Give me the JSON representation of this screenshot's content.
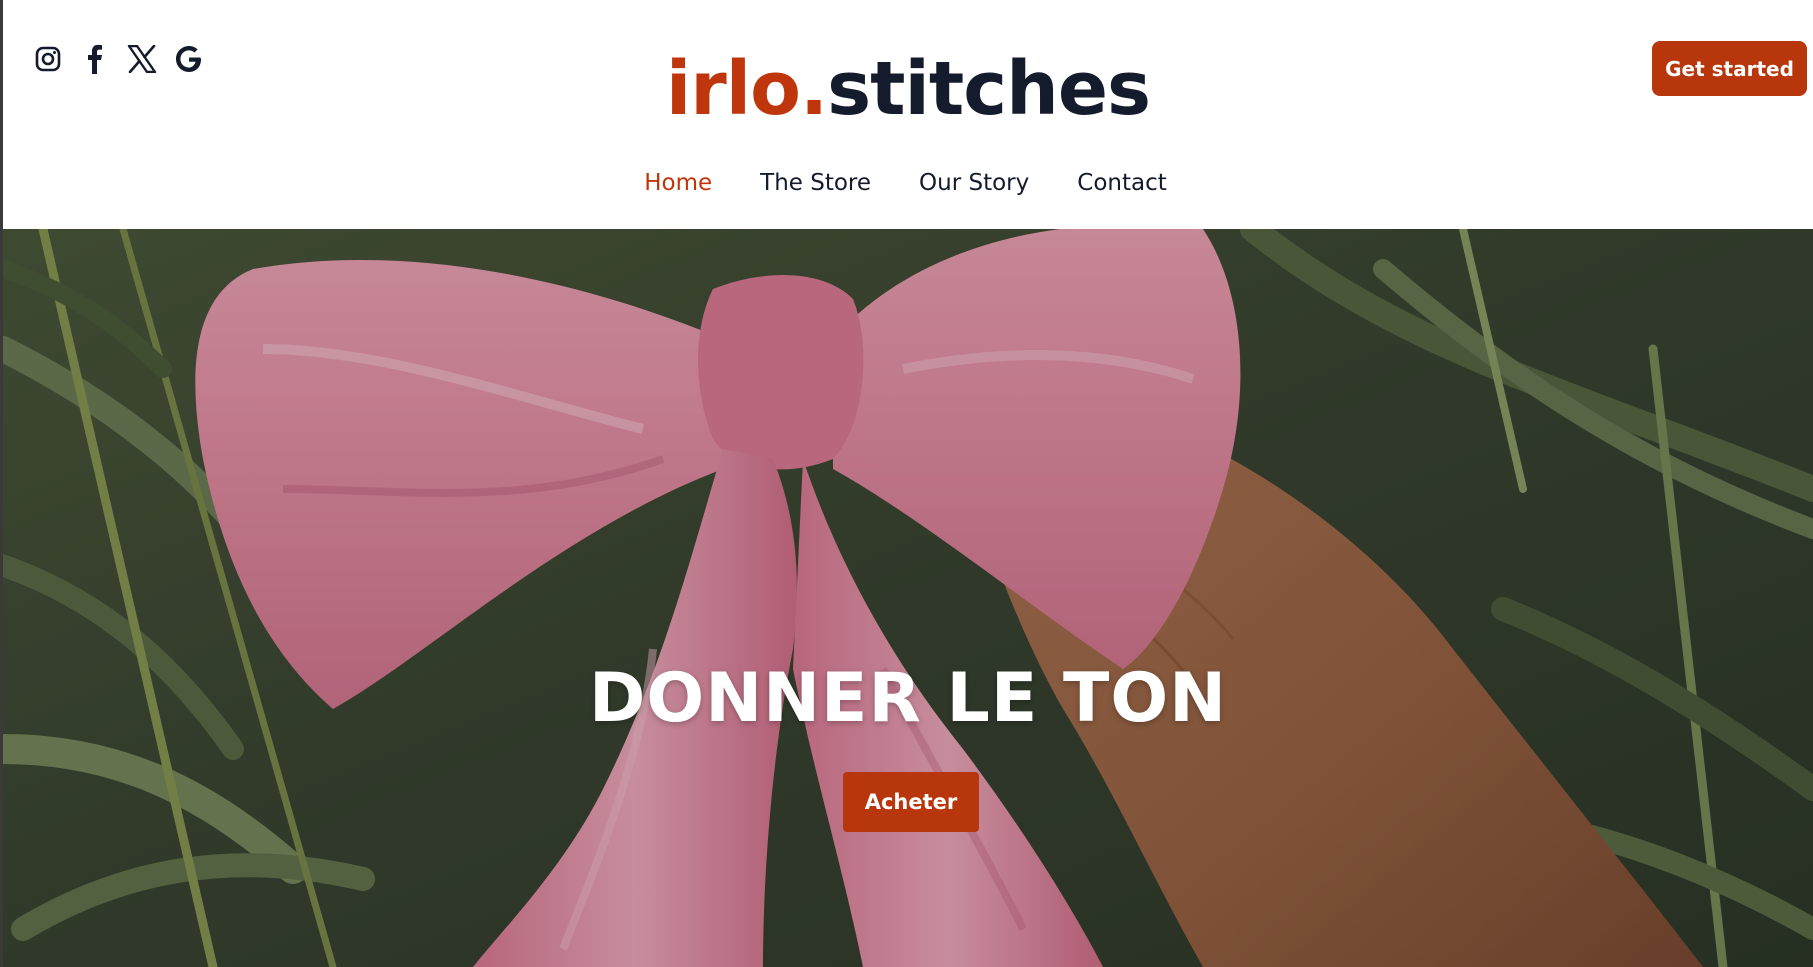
{
  "header": {
    "logo": {
      "part1": "irlo",
      "dot": ".",
      "part2": "stitches"
    },
    "cta_label": "Get started",
    "socials": [
      "instagram-icon",
      "facebook-icon",
      "x-icon",
      "google-icon"
    ]
  },
  "nav": {
    "items": [
      {
        "label": "Home",
        "active": true
      },
      {
        "label": "The Store",
        "active": false
      },
      {
        "label": "Our Story",
        "active": false
      },
      {
        "label": "Contact",
        "active": false
      }
    ]
  },
  "hero": {
    "title": "DONNER LE TON",
    "button_label": "Acheter",
    "image_subject": "pink satin bow held by hand against green foliage"
  },
  "colors": {
    "accent": "#b8360c",
    "logo_accent": "#c0360c",
    "dark_text": "#141b2d",
    "bow_pink": "#e98fa6",
    "foliage": "#3e4a35"
  }
}
